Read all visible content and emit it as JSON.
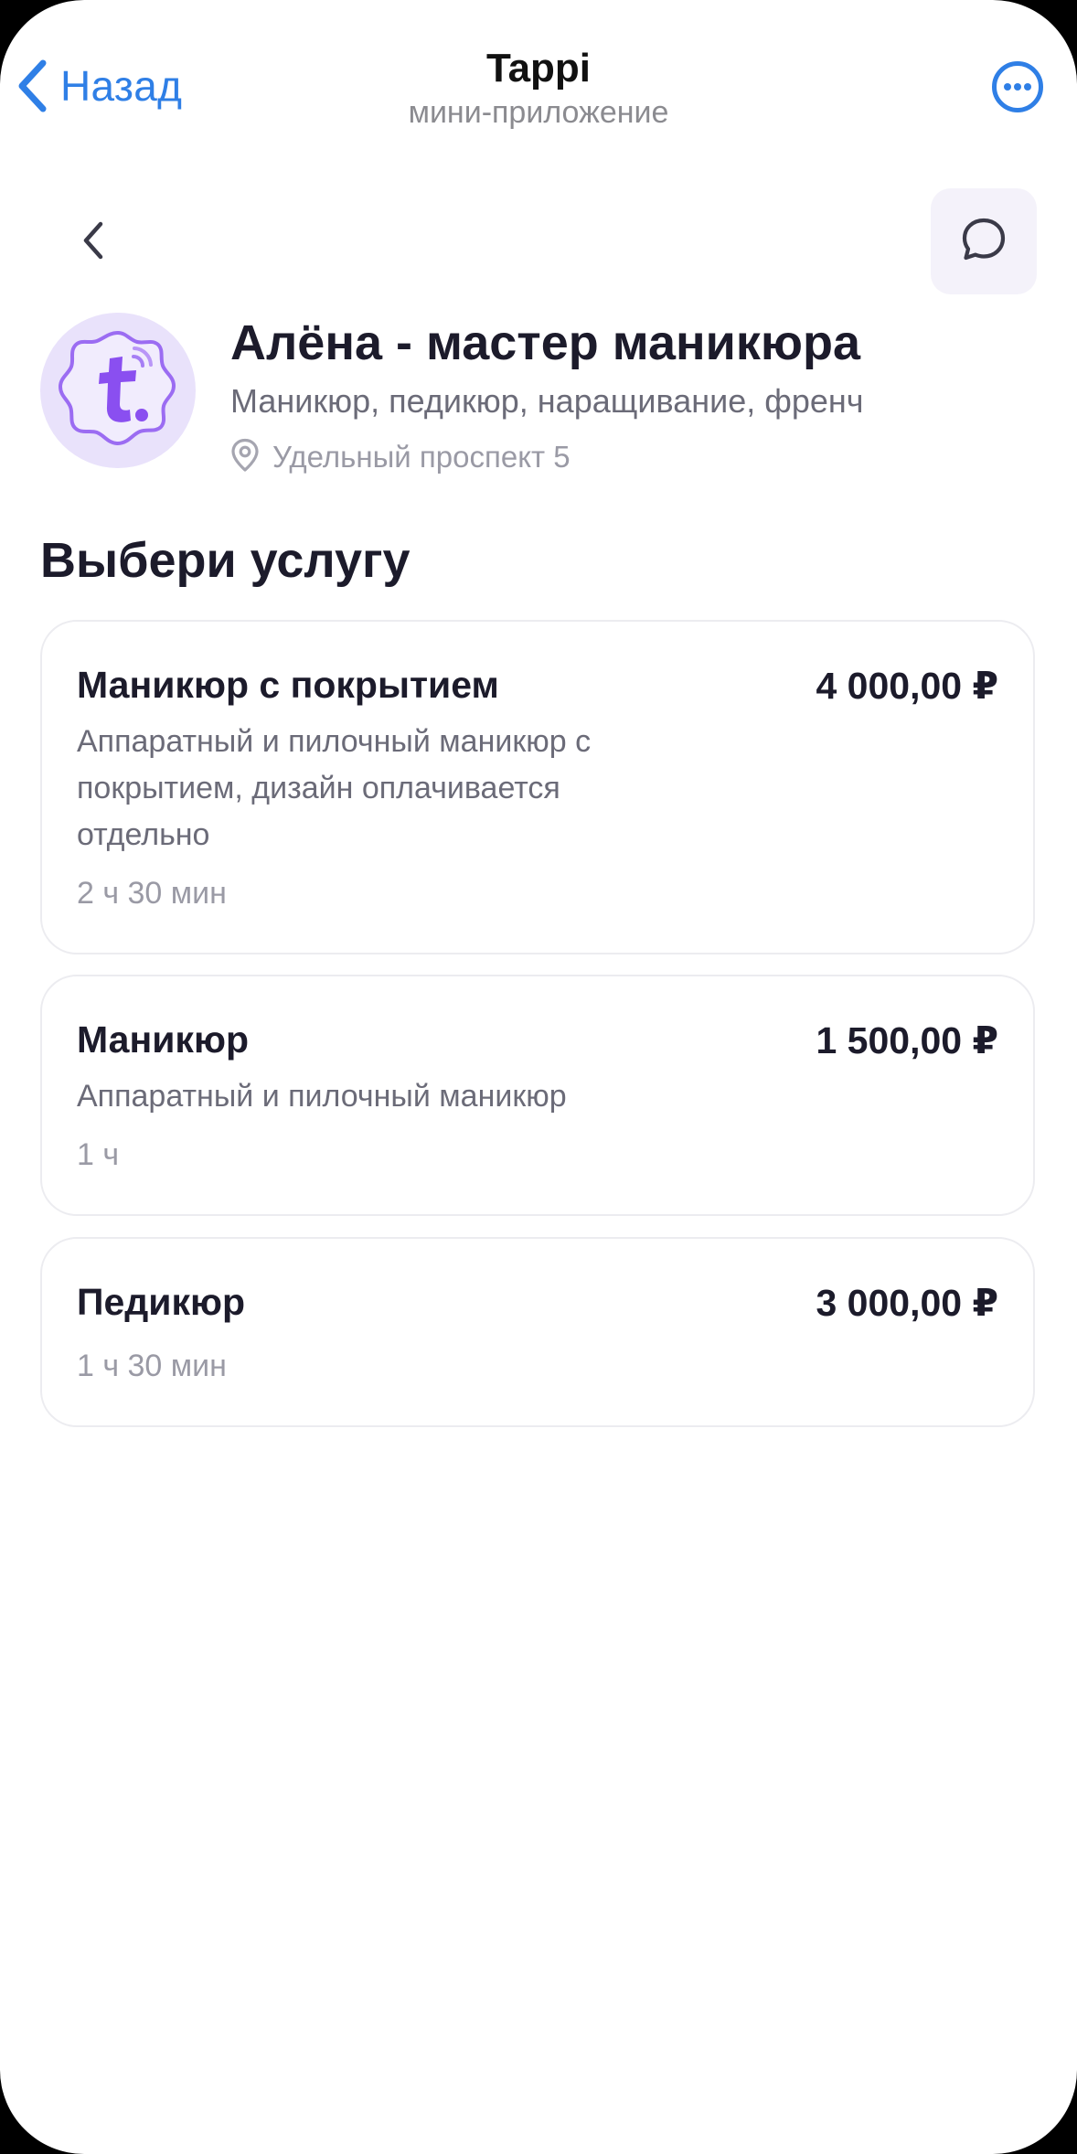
{
  "header": {
    "back_label": "Назад",
    "title": "Tappi",
    "subtitle": "мини-приложение"
  },
  "profile": {
    "name": "Алёна - мастер маникюра",
    "tags": "Маникюр, педикюр, наращивание, френч",
    "address": "Удельный проспект 5"
  },
  "services_section": {
    "title": "Выбери услугу",
    "items": [
      {
        "title": "Маникюр с покрытием",
        "price": "4 000,00 ₽",
        "description": "Аппаратный и пилочный маникюр с покрытием, дизайн оплачивается отдельно",
        "duration": "2 ч 30 мин"
      },
      {
        "title": "Маникюр",
        "price": "1 500,00 ₽",
        "description": "Аппаратный и пилочный маникюр",
        "duration": "1 ч"
      },
      {
        "title": "Педикюр",
        "price": "3 000,00 ₽",
        "description": "",
        "duration": "1 ч 30 мин"
      }
    ]
  },
  "colors": {
    "accent_blue": "#2f7fe6",
    "brand_purple": "#8a4ff0",
    "text_primary": "#1c1b2b",
    "text_secondary": "#6b6b78",
    "text_muted": "#9a9aa5"
  },
  "icons": {
    "back": "chevron-left-icon",
    "more": "more-dots-icon",
    "chat": "chat-bubble-icon",
    "location": "location-pin-icon",
    "logo": "tappi-logo-icon"
  }
}
